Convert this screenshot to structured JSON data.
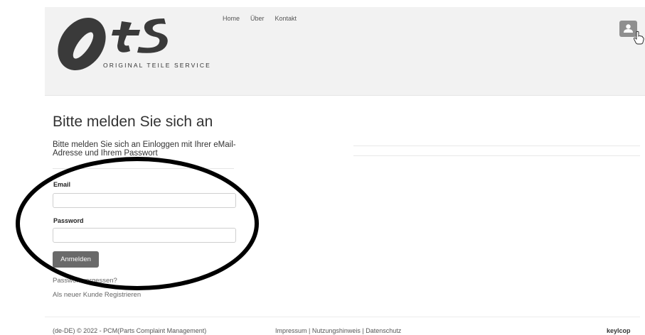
{
  "header": {
    "logo_text": "OTS",
    "logo_subtitle": "ORIGINAL TEILE SERVICE",
    "nav": [
      {
        "label": "Home"
      },
      {
        "label": "Über"
      },
      {
        "label": "Kontakt"
      }
    ],
    "user_icon": "user-icon"
  },
  "main": {
    "title": "Bitte melden Sie sich an",
    "intro": "Bitte melden Sie sich an Einloggen mit Ihrer eMail-Adresse und Ihrem Passwort",
    "email_label": "Email",
    "email_value": "",
    "password_label": "Password",
    "password_value": "",
    "login_button": "Anmelden",
    "forgot_link": "Passwort vergessen?",
    "register_link": "Als neuer Kunde Registrieren"
  },
  "footer": {
    "copyright": "(de-DE) © 2022 - PCM(Parts Complaint Management)",
    "links": [
      "Impressum",
      "Nutzungshinweis",
      "Datenschutz"
    ],
    "separator": " | ",
    "brand": "keylcop"
  },
  "colors": {
    "header_bg": "#f2f2f2",
    "button_bg": "#6a6a6a",
    "annotation": "#000000"
  }
}
